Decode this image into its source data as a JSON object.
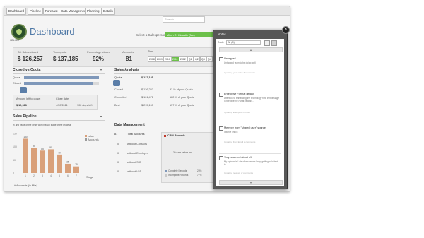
{
  "nav": {
    "tabs": [
      "Dashboard",
      "Pipeline",
      "Forecast",
      "Data Management",
      "Planning",
      "Details"
    ]
  },
  "search": {
    "placeholder": "Search"
  },
  "header": {
    "title": "Dashboard",
    "logo_caption": "HELIUM",
    "salesperson_label": "Select a Salesperson",
    "salesperson_value": "Mitch R. Claustin (Me)"
  },
  "kpis": [
    {
      "label": "Tot Sales closed",
      "value": "$ 126,257"
    },
    {
      "label": "Your quota",
      "value": "$ 137,185"
    },
    {
      "label": "Percentage closed",
      "value": "92%"
    },
    {
      "label": "Accounts",
      "value": "81"
    }
  ],
  "time": {
    "label": "Time",
    "buttons": [
      "2008",
      "2009",
      "2010",
      "2011",
      "2012",
      "Q1",
      "Q2",
      "Q3",
      "Q4"
    ]
  },
  "closed_vs_quota": {
    "title": "Closed vs Quota",
    "quota_label": "Quota",
    "closed_label": "Closed",
    "quota_fraction": 1.0,
    "closed_fraction": 0.92,
    "amount_left_label": "Amount left to close:",
    "amount_left_value": "$ 10,928",
    "close_date_label": "Close date:",
    "close_date_value": "4/30/2011",
    "days_left": "102 days left"
  },
  "sales_analysis": {
    "title": "Sales Analysis",
    "rows": [
      {
        "label": "Quota",
        "value": "$ 137,185",
        "pct": ""
      },
      {
        "label": "Closed",
        "value": "$ 126,257",
        "pct": "92 % of your Quota"
      },
      {
        "label": "Commited",
        "value": "$ 101,471",
        "pct": "122 % of your Quota"
      },
      {
        "label": "Best",
        "value": "$ 215,153",
        "pct": "157 % of your Quota"
      }
    ]
  },
  "pipeline": {
    "title": "Sales Pipeline",
    "subtitle": "% and value of the deals won in each stage of the process",
    "legend": [
      "value",
      "Accounts"
    ],
    "stage_label": "Stage",
    "footer_label": "# Accounts (in Mils)",
    "chart_data": {
      "type": "bar",
      "categories": [
        "1",
        "2",
        "3",
        "4",
        "5",
        "6",
        "7"
      ],
      "values": [
        130,
        95,
        85,
        90,
        70,
        35,
        25
      ],
      "ylim": [
        0,
        150
      ],
      "yticks": [
        "150",
        "100",
        "50",
        "0"
      ]
    }
  },
  "data_management": {
    "title": "Data Management",
    "rows": [
      {
        "count": "81",
        "label": "Total Accounts"
      },
      {
        "count": "0",
        "label": "without Contacts"
      },
      {
        "count": "0",
        "label": "without Employer"
      },
      {
        "count": "0",
        "label": "without SIC"
      },
      {
        "count": "0",
        "label": "without VAT"
      }
    ],
    "crm_title": "CRM Records",
    "crm_center": "30 days before fwd",
    "crm_legend": [
      {
        "label": "Complete Records",
        "pct": "23%"
      },
      {
        "label": "Incomplete Records",
        "pct": "77%"
      }
    ]
  },
  "footer": {
    "text": "Last updated on June 01, 2011"
  },
  "notes_panel": {
    "title": "Notes",
    "filter_label": "Note",
    "filter_value": "All (5)",
    "notes": [
      {
        "title": "Untagged",
        "text": "Untagged team to be doing well",
        "meta": "Updating your order & comments"
      },
      {
        "title": "Enterprise Format default",
        "text": "Attention to enhancing the technology field in this stage in the pipeline (what field is)...",
        "meta": "Updating Enterprise Format"
      },
      {
        "title": "Member from \"shared user\" source",
        "text": "Info file check",
        "meta": "Updating from Email 2 comments"
      },
      {
        "title": "Very reserved about UI",
        "text": "My opinion is Lots of customers keep getting cold feet to...",
        "meta": "Updating reviews of comments"
      }
    ]
  },
  "colors": {
    "accent": "#4e78a6",
    "select_green": "#6cc04a",
    "bar_orange": "#d9a07a",
    "crm_red": "#c0392b",
    "notes_dark": "#575757"
  }
}
